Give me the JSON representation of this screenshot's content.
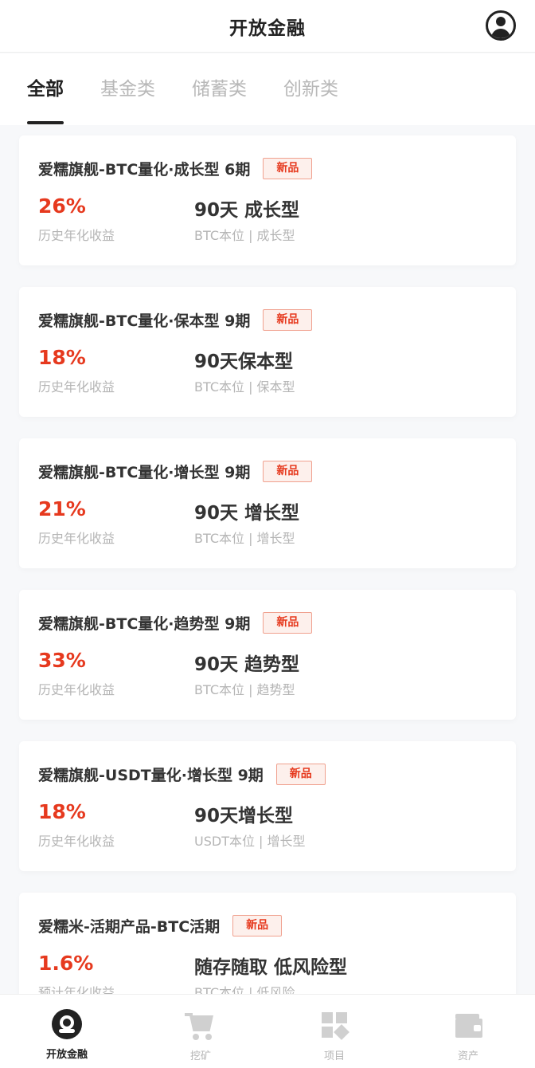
{
  "header": {
    "title": "开放金融",
    "avatar_icon": "user-circle-icon"
  },
  "tabs": [
    {
      "label": "全部",
      "active": true
    },
    {
      "label": "基金类",
      "active": false
    },
    {
      "label": "储蓄类",
      "active": false
    },
    {
      "label": "创新类",
      "active": false
    }
  ],
  "products": [
    {
      "title": "爱糯旗舰-BTC量化·成长型 6期",
      "badge": "新品",
      "rate": "26%",
      "rate_label": "历史年化收益",
      "term": "90天 成长型",
      "sub": "BTC本位 | 成长型"
    },
    {
      "title": "爱糯旗舰-BTC量化·保本型 9期",
      "badge": "新品",
      "rate": "18%",
      "rate_label": "历史年化收益",
      "term": "90天保本型",
      "sub": "BTC本位 | 保本型"
    },
    {
      "title": "爱糯旗舰-BTC量化·增长型 9期",
      "badge": "新品",
      "rate": "21%",
      "rate_label": "历史年化收益",
      "term": "90天 增长型",
      "sub": "BTC本位 | 增长型"
    },
    {
      "title": "爱糯旗舰-BTC量化·趋势型 9期",
      "badge": "新品",
      "rate": "33%",
      "rate_label": "历史年化收益",
      "term": "90天 趋势型",
      "sub": "BTC本位 | 趋势型"
    },
    {
      "title": "爱糯旗舰-USDT量化·增长型 9期",
      "badge": "新品",
      "rate": "18%",
      "rate_label": "历史年化收益",
      "term": "90天增长型",
      "sub": "USDT本位 | 增长型"
    },
    {
      "title": "爱糯米-活期产品-BTC活期",
      "badge": "新品",
      "rate": "1.6%",
      "rate_label": "预计年化收益",
      "term": "随存随取 低风险型",
      "sub": "BTC本位 | 低风险"
    }
  ],
  "bottom_nav": [
    {
      "label": "开放金融",
      "icon": "finance-icon",
      "active": true
    },
    {
      "label": "挖矿",
      "icon": "mining-cart-icon",
      "active": false
    },
    {
      "label": "项目",
      "icon": "project-grid-icon",
      "active": false
    },
    {
      "label": "资产",
      "icon": "wallet-icon",
      "active": false
    }
  ],
  "colors": {
    "accent": "#e6391e",
    "text": "#333333",
    "muted": "#b5b5b5",
    "background": "#f7f8fa"
  }
}
